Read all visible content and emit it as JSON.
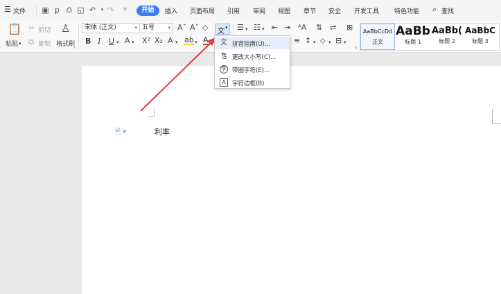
{
  "menubar": {
    "file_label": "文件",
    "tabs": [
      "开始",
      "插入",
      "页面布局",
      "引用",
      "审阅",
      "视图",
      "章节",
      "安全",
      "开发工具",
      "特色功能"
    ],
    "search_label": "查找"
  },
  "ribbon": {
    "paste_label": "粘贴",
    "cut_label": "剪切",
    "copy_label": "复制",
    "format_painter_label": "格式刷",
    "font_name": "宋体 (正文)",
    "font_size": "五号",
    "bold": "B",
    "italic": "I",
    "underline": "U",
    "char_button": "文"
  },
  "styles": [
    {
      "preview": "AaBbCcDd",
      "name": "正文"
    },
    {
      "preview": "AaBb",
      "name": "标题 1"
    },
    {
      "preview": "AaBb(",
      "name": "标题 2"
    },
    {
      "preview": "AaBbC",
      "name": "标题 3"
    }
  ],
  "dropdown": {
    "items": [
      {
        "icon": "pinyin-icon",
        "label": "拼音指南(U)..."
      },
      {
        "icon": "change-case-icon",
        "label": "更改大小写(C)..."
      },
      {
        "icon": "enclosed-char-icon",
        "label": "带圈字符(E)..."
      },
      {
        "icon": "char-border-icon",
        "label": "字符边框(B)"
      }
    ]
  },
  "document": {
    "text": "利率"
  },
  "colors": {
    "accent": "#3f7df0",
    "arrow": "#e23b3b"
  }
}
